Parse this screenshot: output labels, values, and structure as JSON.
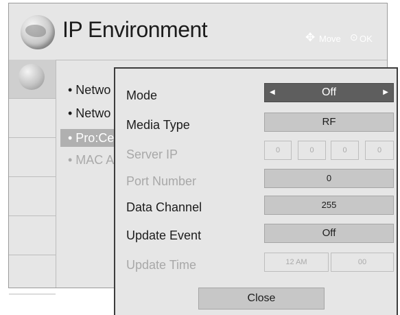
{
  "window": {
    "title": "IP Environment",
    "hints": {
      "move_label": "Move",
      "ok_label": "OK"
    }
  },
  "menu_items": [
    {
      "label": "• Netwo"
    },
    {
      "label": "• Netwo"
    },
    {
      "label": "• Pro:Ce"
    },
    {
      "label": "• MAC A"
    }
  ],
  "dialog": {
    "mode": {
      "label": "Mode",
      "value": "Off"
    },
    "media_type": {
      "label": "Media Type",
      "value": "RF"
    },
    "server_ip": {
      "label": "Server IP",
      "octets": [
        "0",
        "0",
        "0",
        "0"
      ]
    },
    "port_number": {
      "label": "Port Number",
      "value": "0"
    },
    "data_channel": {
      "label": "Data Channel",
      "value": "255"
    },
    "update_event": {
      "label": "Update Event",
      "value": "Off"
    },
    "update_time": {
      "label": "Update Time",
      "hour": "12 AM",
      "minute": "00"
    },
    "close_label": "Close"
  },
  "colors": {
    "panel_bg": "#e6e6e6",
    "field_bg": "#c7c7c7",
    "selected_field_bg": "#5e5e5e",
    "highlight_item_bg": "#b0b0b0",
    "disabled_text": "#a8a8a8"
  },
  "icons": [
    "globe-icon",
    "move-arrows-icon",
    "ok-circle-icon",
    "left-arrow-icon",
    "right-arrow-icon"
  ]
}
